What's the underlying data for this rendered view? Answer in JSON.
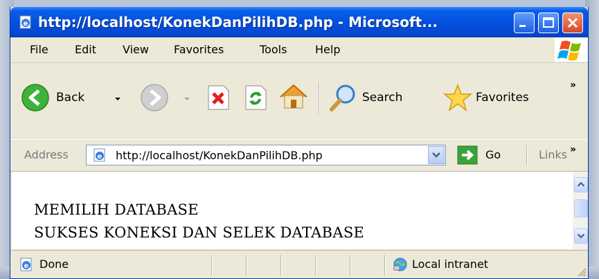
{
  "window": {
    "title": "http://localhost/KonekDanPilihDB.php - Microsoft...",
    "accent": "#0a5ee8",
    "close_color": "#d8452a"
  },
  "menu": {
    "items": [
      {
        "label": "File",
        "id": "file"
      },
      {
        "label": "Edit",
        "id": "edit"
      },
      {
        "label": "View",
        "id": "view"
      },
      {
        "label": "Favorites",
        "id": "favorites"
      },
      {
        "label": "Tools",
        "id": "tools"
      },
      {
        "label": "Help",
        "id": "help"
      }
    ]
  },
  "toolbar": {
    "back_label": "Back",
    "search_label": "Search",
    "favorites_label": "Favorites",
    "overflow_glyph": "»"
  },
  "address": {
    "label": "Address",
    "url": "http://localhost/KonekDanPilihDB.php",
    "go_label": "Go",
    "links_label": "Links",
    "overflow_glyph": "»"
  },
  "content": {
    "lines": [
      "MEMILIH DATABASE",
      "SUKSES KONEKSI DAN SELEK DATABASE"
    ]
  },
  "status": {
    "text": "Done",
    "zone": "Local intranet"
  },
  "icons": {
    "page": "ie-page-icon",
    "back": "back-arrow-icon",
    "forward": "forward-arrow-icon",
    "stop": "stop-icon",
    "refresh": "refresh-icon",
    "home": "home-icon",
    "search": "search-icon",
    "favorites": "favorites-star-icon",
    "go": "go-arrow-icon",
    "zone": "local-intranet-icon"
  }
}
